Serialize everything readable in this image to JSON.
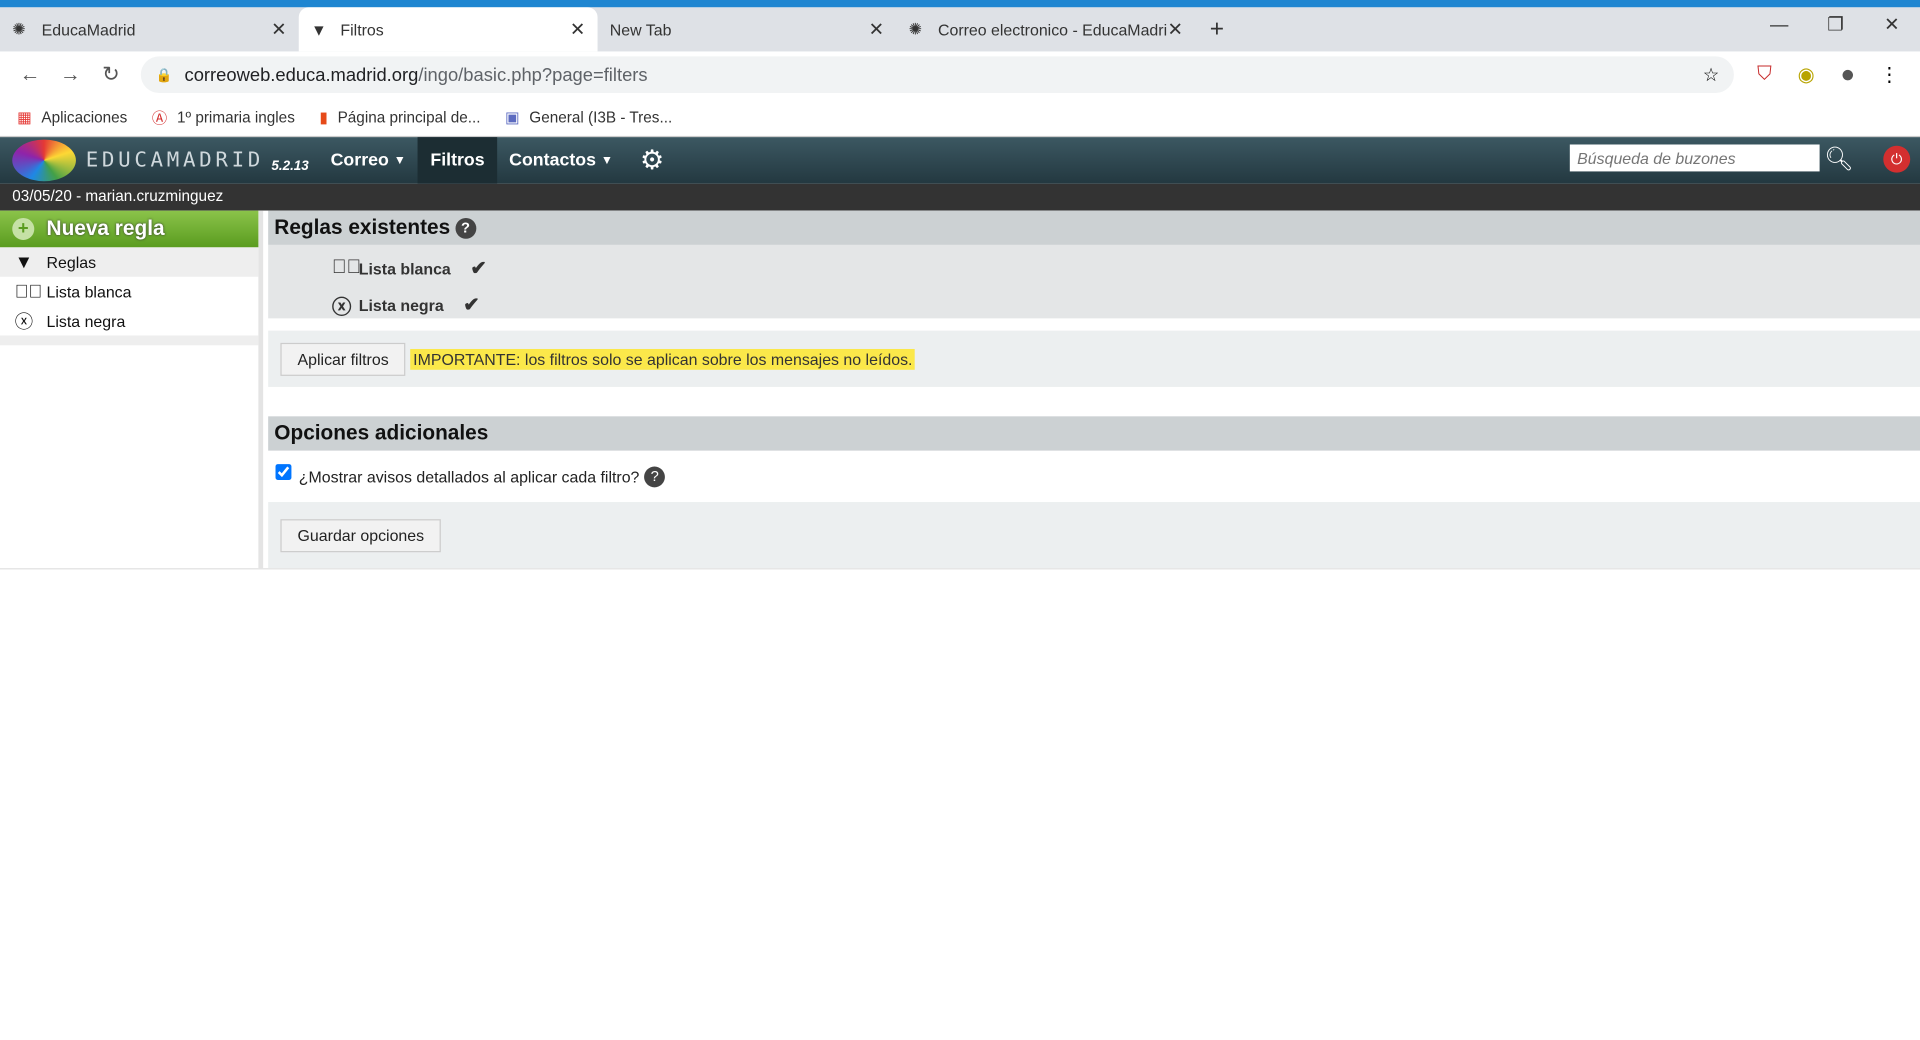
{
  "browser": {
    "tabs": [
      {
        "title": "EducaMadrid",
        "icon": "educamadrid-icon",
        "active": false
      },
      {
        "title": "Filtros",
        "icon": "filter-icon",
        "active": true
      },
      {
        "title": "New Tab",
        "icon": "",
        "active": false
      },
      {
        "title": "Correo electronico - EducaMadrid",
        "icon": "educamadrid-icon",
        "active": false
      }
    ],
    "url_host": "correoweb.educa.madrid.org",
    "url_path": "/ingo/basic.php?page=filters",
    "bookmarks": [
      {
        "label": "Aplicaciones",
        "icon": "apps-grid-icon"
      },
      {
        "label": "1º primaria ingles",
        "icon": "angular-icon"
      },
      {
        "label": "Página principal de...",
        "icon": "office-icon"
      },
      {
        "label": "General (I3B - Tres...",
        "icon": "teams-icon"
      }
    ]
  },
  "app": {
    "logo_text": "EDUCAMADRID",
    "version": "5.2.13",
    "menu": {
      "correo": "Correo",
      "filtros": "Filtros",
      "contactos": "Contactos"
    },
    "search_placeholder": "Búsqueda de buzones",
    "user_line": "03/05/20 - marian.cruzminguez"
  },
  "sidebar": {
    "new_rule": "Nueva regla",
    "items": [
      {
        "label": "Reglas"
      },
      {
        "label": "Lista blanca"
      },
      {
        "label": "Lista negra"
      }
    ]
  },
  "main": {
    "rules_title": "Reglas existentes",
    "rules": [
      {
        "name": "Lista blanca",
        "enabled": true
      },
      {
        "name": "Lista negra",
        "enabled": true
      }
    ],
    "apply_button": "Aplicar filtros",
    "important": "IMPORTANTE: los filtros solo se aplican sobre los mensajes no leídos.",
    "options_title": "Opciones adicionales",
    "option_label": "¿Mostrar avisos detallados al aplicar cada filtro?",
    "option_checked": true,
    "save_button": "Guardar opciones"
  },
  "colors": {
    "accent": "#1f86d1",
    "header": "#2f4850",
    "new_rule": "#6fae2c",
    "highlight": "#fbe84a"
  }
}
